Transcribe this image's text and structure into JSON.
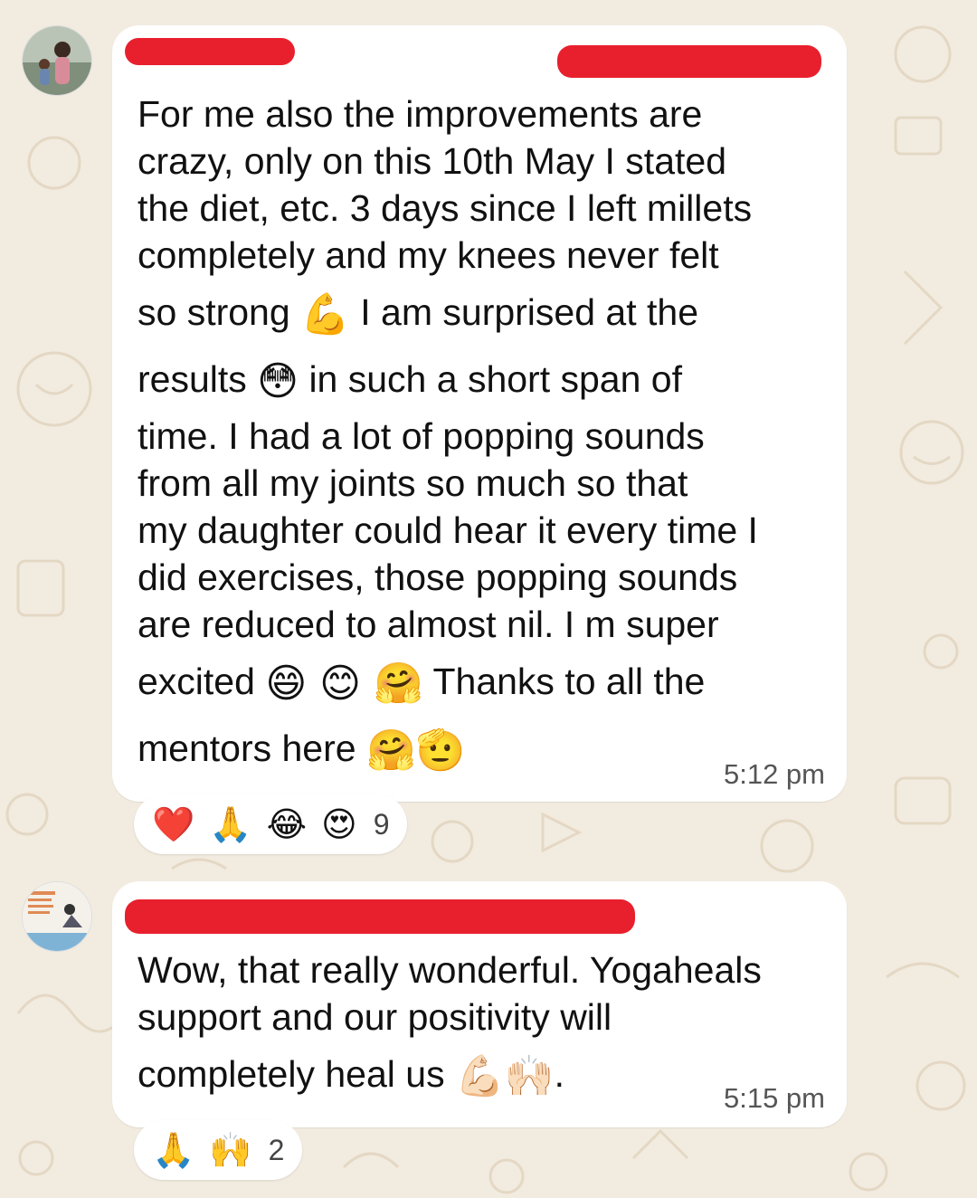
{
  "messages": [
    {
      "lines": [
        "For me also the improvements are",
        "crazy, only on this 10th May I stated",
        "the diet, etc. 3 days since I left millets",
        "completely and my knees never felt"
      ],
      "line5_a": "so strong",
      "line5_emoji": "💪",
      "line5_b": "I am surprised at the",
      "line6_a": "results",
      "line6_emoji": "😳",
      "line6_b": "in such a short span of",
      "lines2": [
        "time.  I had a lot of popping sounds",
        "from all my joints so much so that",
        "my daughter could hear it every time I",
        "did exercises, those popping sounds",
        "are reduced to almost nil. I m super"
      ],
      "line12_a": "excited",
      "line12_emojis": "😄 😊 🤗",
      "line12_b": "Thanks to all the",
      "line13_a": "mentors here",
      "line13_emojis": "🤗🫡",
      "time": "5:12 pm",
      "reactions": {
        "emojis": [
          "❤️",
          "🙏",
          "😂",
          "😍"
        ],
        "count": "9"
      }
    },
    {
      "lines": [
        "Wow, that really wonderful. Yogaheals",
        "support and our positivity will"
      ],
      "line3_a": "completely heal us",
      "line3_emojis": "💪🏻🙌🏻",
      "line3_b": ".",
      "time": "5:15 pm",
      "reactions": {
        "emojis": [
          "🙏",
          "🙌"
        ],
        "count": "2"
      }
    }
  ],
  "colors": {
    "redaction": "#e8202e",
    "background": "#f2ebe0",
    "bubble": "#ffffff"
  }
}
